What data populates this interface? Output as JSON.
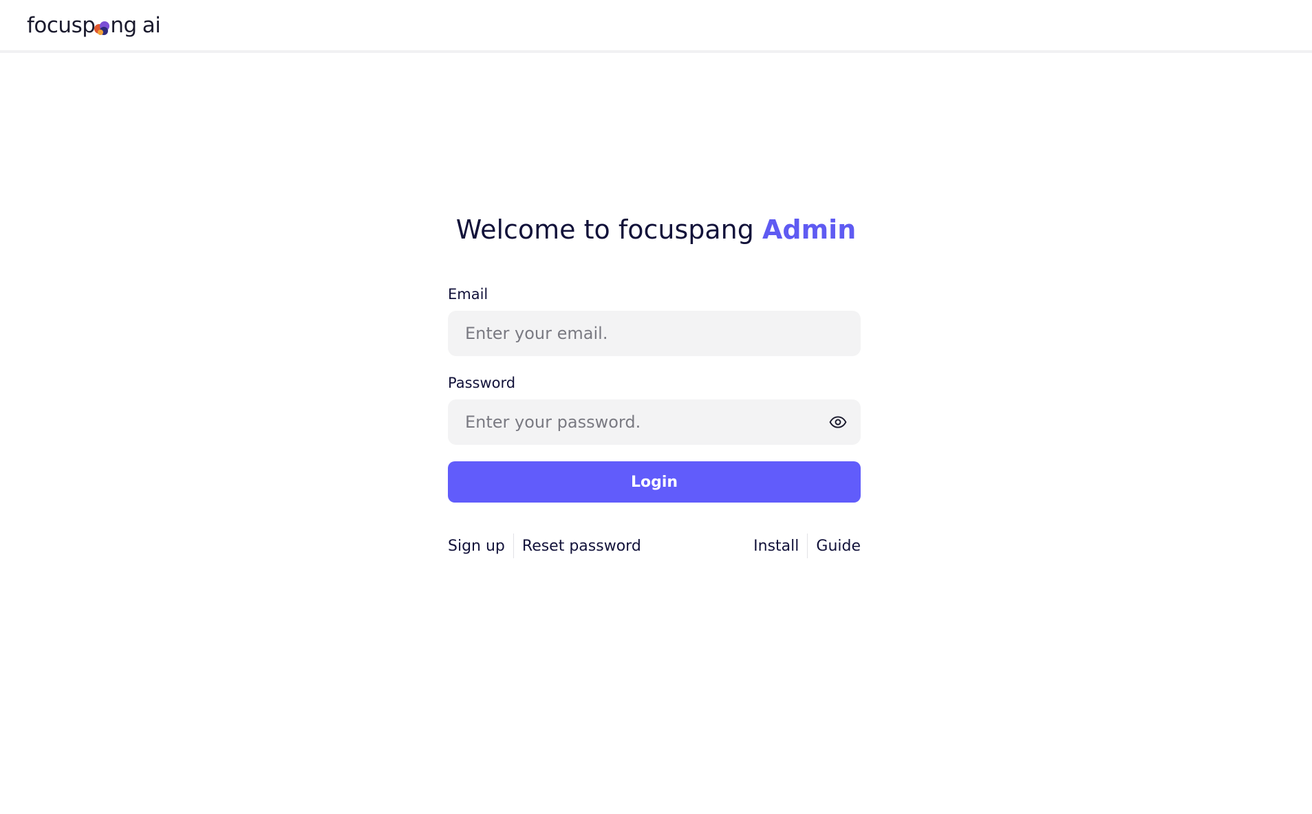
{
  "header": {
    "logo_prefix": "focusp",
    "logo_middle": "ng",
    "logo_suffix": "ai",
    "logo_icon": "colorful-logo-icon"
  },
  "heading": {
    "text": "Welcome to focuspang",
    "accent": "Admin"
  },
  "form": {
    "email_label": "Email",
    "email_placeholder": "Enter your email.",
    "email_value": "",
    "password_label": "Password",
    "password_placeholder": "Enter your password.",
    "password_value": "",
    "password_toggle_icon": "eye-icon",
    "login_label": "Login"
  },
  "links": {
    "signup": "Sign up",
    "reset_password": "Reset password",
    "install": "Install",
    "guide": "Guide"
  },
  "colors": {
    "accent": "#615cfb",
    "heading_accent": "#5f5bf2",
    "input_bg": "#f3f3f4",
    "text": "#12123a"
  }
}
